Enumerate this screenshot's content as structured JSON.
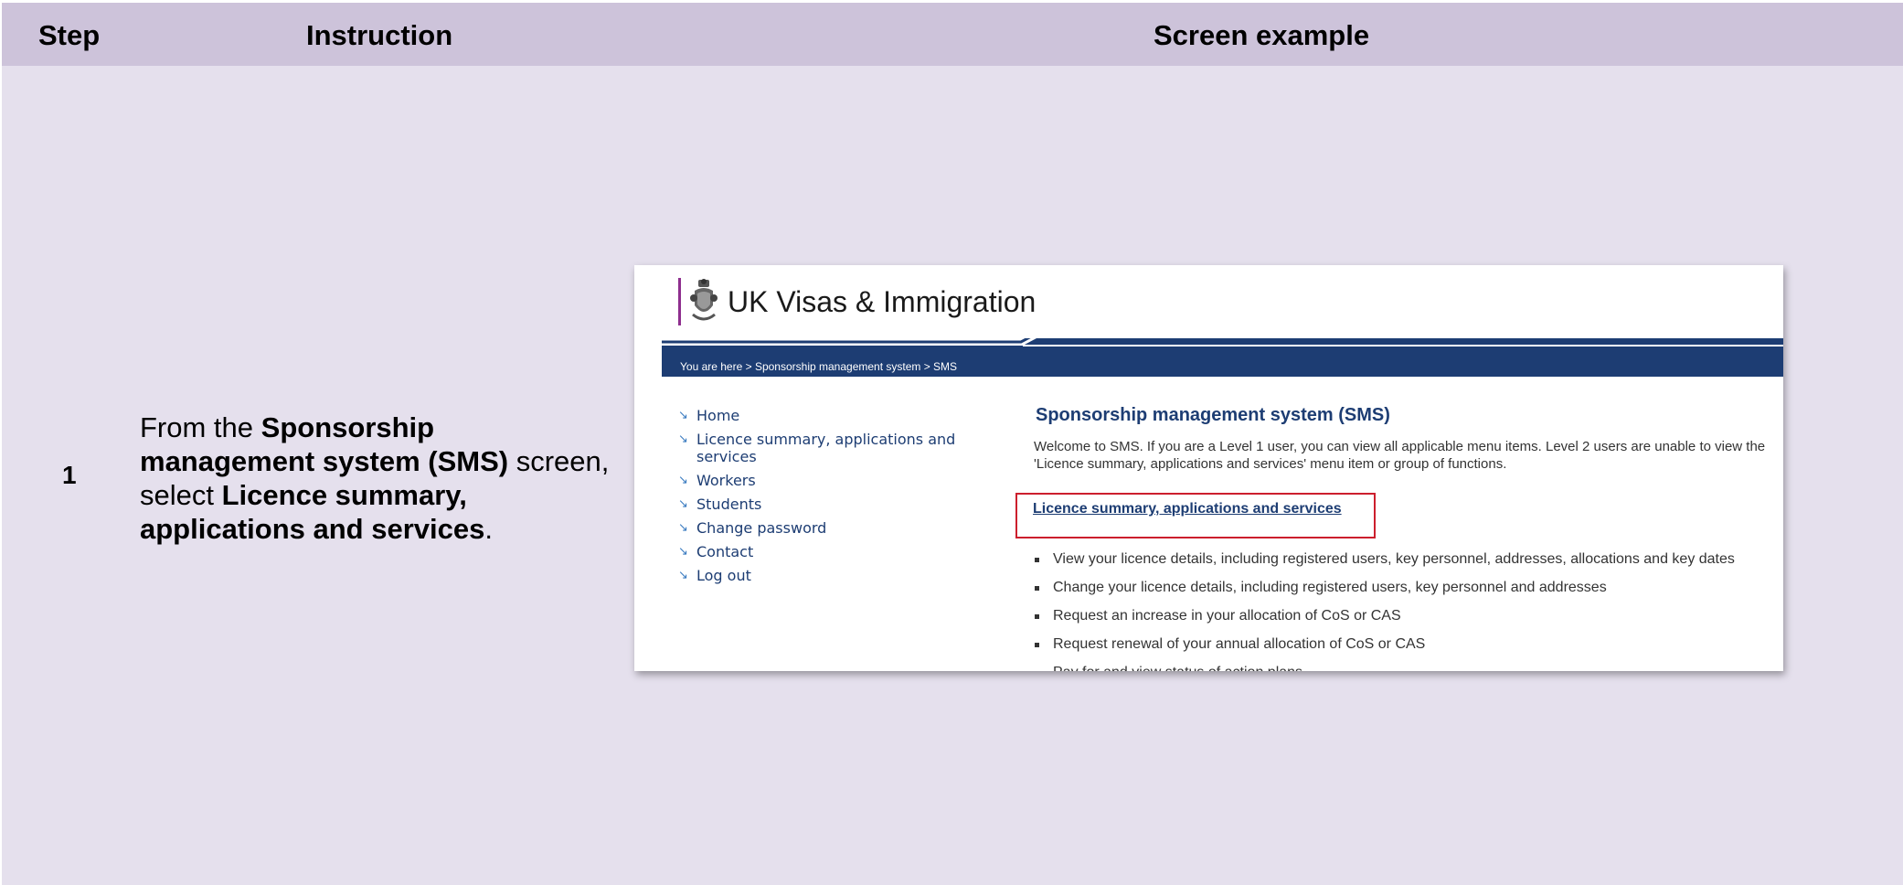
{
  "header": {
    "step": "Step",
    "instruction": "Instruction",
    "screen_example": "Screen example"
  },
  "row": {
    "step_number": "1",
    "instruction": {
      "part1": "From the ",
      "bold1": "Sponsorship management system (SMS)",
      "part2": " screen, select ",
      "bold2": "Licence summary, applications and services",
      "part3": "."
    }
  },
  "screenshot": {
    "brand": "UK Visas & Immigration",
    "breadcrumb": "You are here > Sponsorship management system > SMS",
    "nav_items": [
      "Home",
      "Licence summary, applications and services",
      "Workers",
      "Students",
      "Change password",
      "Contact",
      "Log out"
    ],
    "title": "Sponsorship management system (SMS)",
    "welcome": "Welcome to SMS. If you are a Level 1 user, you can view all applicable menu items. Level 2 users are unable to view the 'Licence summary, applications and services' menu item or group of functions.",
    "link": "Licence summary, applications and services",
    "bullets": [
      "View your licence details, including registered users, key personnel, addresses, allocations and key dates",
      "Change your licence details, including registered users, key personnel and addresses",
      "Request an increase in your allocation of CoS or CAS",
      "Request renewal of your annual allocation of CoS or CAS",
      "Pay for and view status of action plans"
    ]
  },
  "colors": {
    "header_bg": "#cdc3da",
    "row_bg": "#e5e0ed",
    "banner": "#1d3d73",
    "highlight_box": "#cc1f2d",
    "logo_bar": "#8e2e8e"
  }
}
